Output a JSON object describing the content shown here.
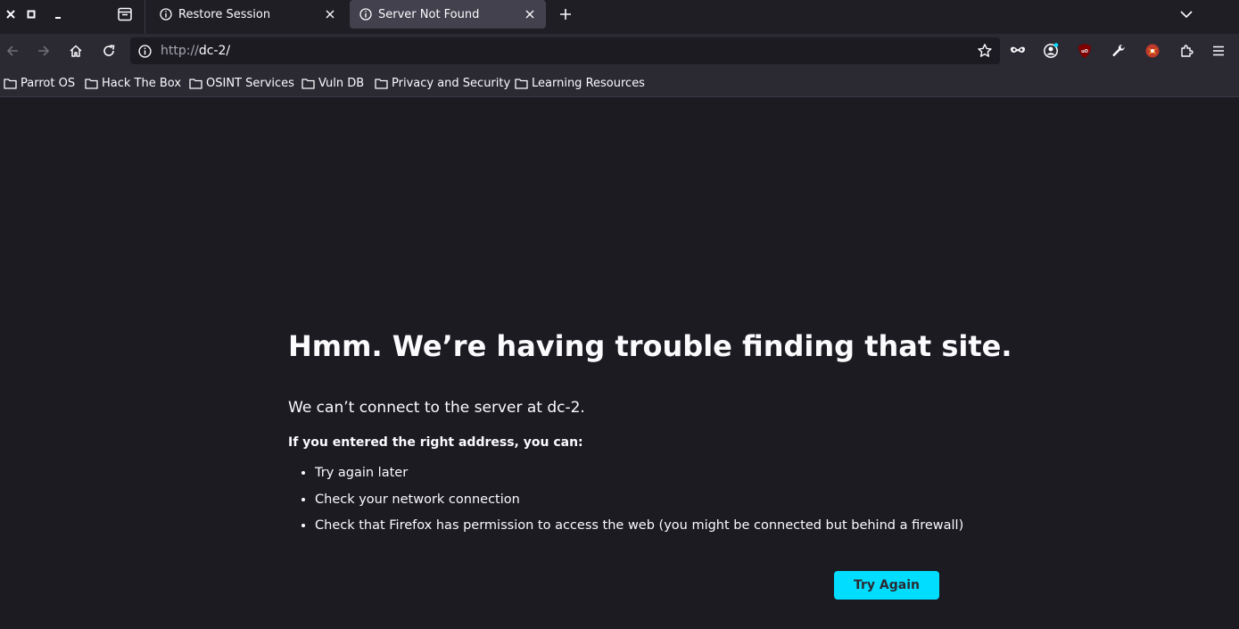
{
  "window": {
    "close_label": "×",
    "maximize_label": "□",
    "minimize_label": "–"
  },
  "tabs": [
    {
      "title": "Restore Session",
      "active": false
    },
    {
      "title": "Server Not Found",
      "active": true
    }
  ],
  "navbar": {
    "url_scheme": "http://",
    "url_host": "dc-2/"
  },
  "bookmarks": [
    {
      "label": "Parrot OS"
    },
    {
      "label": "Hack The Box"
    },
    {
      "label": "OSINT Services"
    },
    {
      "label": "Vuln DB"
    },
    {
      "label": "Privacy and Security"
    },
    {
      "label": "Learning Resources"
    }
  ],
  "error_page": {
    "title": "Hmm. We’re having trouble finding that site.",
    "description": "We can’t connect to the server at dc-2.",
    "intro": "If you entered the right address, you can:",
    "suggestions": [
      "Try again later",
      "Check your network connection",
      "Check that Firefox has permission to access the web (you might be connected but behind a firewall)"
    ],
    "button_label": "Try Again"
  },
  "colors": {
    "accent": "#00ddff",
    "background": "#1c1b22",
    "toolbar": "#2b2a33",
    "ublock_badge": "#800000"
  }
}
